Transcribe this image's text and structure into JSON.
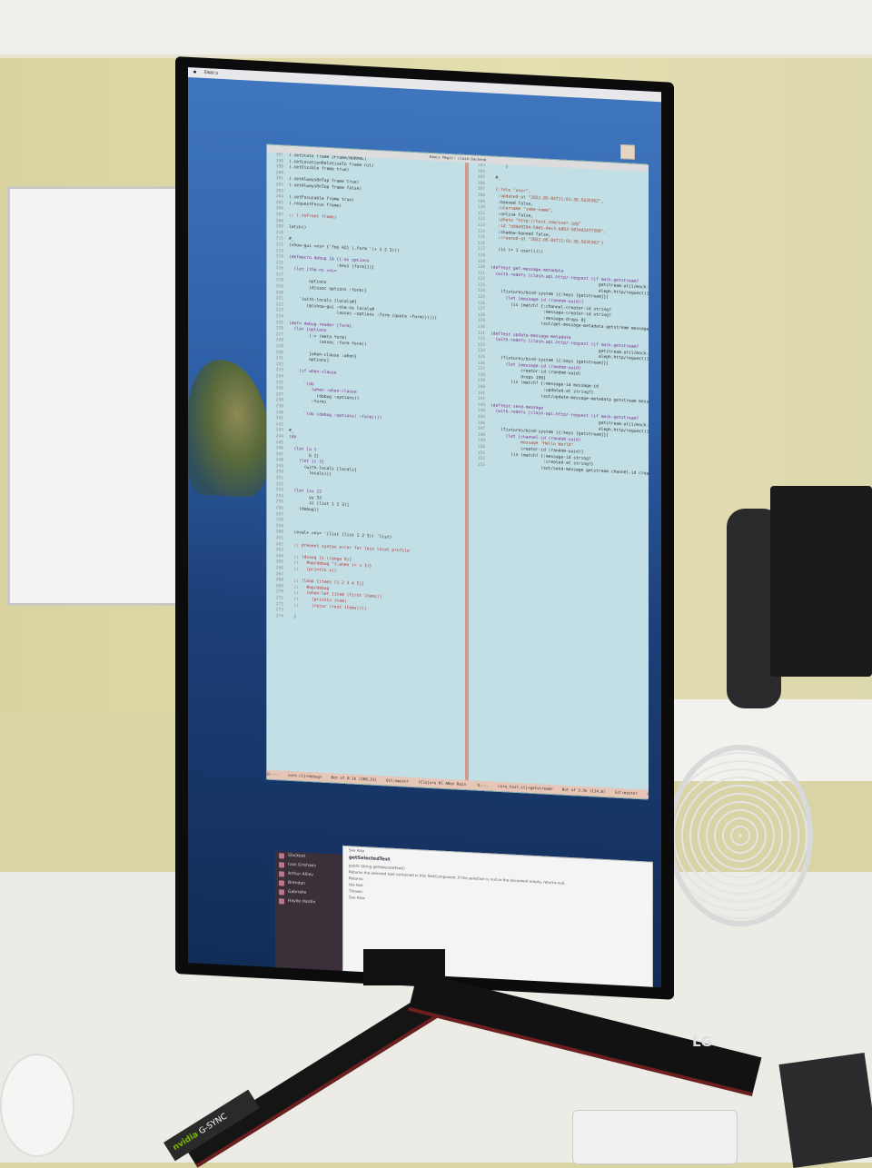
{
  "menubar": {
    "app": "Emacs"
  },
  "emacs": {
    "title": "Emacs Magit: clash-backend",
    "left_lines": [
      {
        "n": "197",
        "t": "(.setState frame JFrame/NORMAL)"
      },
      {
        "n": "198",
        "t": "(.setLocationRelativeTo frame nil)"
      },
      {
        "n": "199",
        "t": "(.setVisible frame true)"
      },
      {
        "n": "200",
        "t": ""
      },
      {
        "n": "201",
        "t": "(.setAlwaysOnTop frame true)"
      },
      {
        "n": "202",
        "t": "(.setAlwaysOnTop frame false)"
      },
      {
        "n": "203",
        "t": ""
      },
      {
        "n": "204",
        "t": "(.setFocusable frame true)"
      },
      {
        "n": "205",
        "t": "(.requestFocus frame)"
      },
      {
        "n": "206",
        "t": ""
      },
      {
        "n": "207",
        "t": ";; (.toFront frame)"
      },
      {
        "n": "208",
        "t": ""
      },
      {
        "n": "209",
        "t": "latch))"
      },
      {
        "n": "210",
        "t": ""
      },
      {
        "n": "211",
        "t": "#_"
      },
      {
        "n": "212",
        "t": "(show-gui =ns= {'foo 42} (.form '(+ 1 2 3)))"
      },
      {
        "n": "213",
        "t": ""
      },
      {
        "n": "214",
        "t": "(defmacro debug [& [{:as options"
      },
      {
        "n": "215",
        "t": "                   :keys [form]}]]"
      },
      {
        "n": "216",
        "t": "  (let [the-ns =ns="
      },
      {
        "n": "217",
        "t": ""
      },
      {
        "n": "218",
        "t": "        options"
      },
      {
        "n": "219",
        "t": "        (dissoc options :form)]"
      },
      {
        "n": "220",
        "t": ""
      },
      {
        "n": "221",
        "t": "    `(with-locals [locals#]"
      },
      {
        "n": "222",
        "t": "       (@(show-gui ~the-ns locals#"
      },
      {
        "n": "223",
        "t": "                   (assoc ~options :form (quote ~form))))))"
      },
      {
        "n": "224",
        "t": ""
      },
      {
        "n": "225",
        "t": "(defn debug-reader [form]"
      },
      {
        "n": "226",
        "t": "  (let [options"
      },
      {
        "n": "227",
        "t": "        (-> (meta form)"
      },
      {
        "n": "228",
        "t": "            (assoc :form form))"
      },
      {
        "n": "229",
        "t": ""
      },
      {
        "n": "230",
        "t": "        [when-clause :when}"
      },
      {
        "n": "231",
        "t": "        options]"
      },
      {
        "n": "232",
        "t": ""
      },
      {
        "n": "233",
        "t": "    (if when-clause"
      },
      {
        "n": "234",
        "t": ""
      },
      {
        "n": "235",
        "t": "      `(do"
      },
      {
        "n": "236",
        "t": "         (when ~when-clause"
      },
      {
        "n": "237",
        "t": "           (debug ~options))"
      },
      {
        "n": "238",
        "t": "         ~form)"
      },
      {
        "n": "239",
        "t": ""
      },
      {
        "n": "240",
        "t": "      `(do (debug ~options) ~form))))"
      },
      {
        "n": "241",
        "t": ""
      },
      {
        "n": "242",
        "t": ""
      },
      {
        "n": "243",
        "t": "#_"
      },
      {
        "n": "244",
        "t": "(do"
      },
      {
        "n": "245",
        "t": ""
      },
      {
        "n": "246",
        "t": "  (let [a 1"
      },
      {
        "n": "247",
        "t": "        b 2]"
      },
      {
        "n": "248",
        "t": "    (let [c 3]"
      },
      {
        "n": "249",
        "t": "      (with-locals [locals]"
      },
      {
        "n": "250",
        "t": "        locals)))"
      },
      {
        "n": "251",
        "t": ""
      },
      {
        "n": "252",
        "t": ""
      },
      {
        "n": "253",
        "t": "  (let [xx 22"
      },
      {
        "n": "254",
        "t": "        yy 33"
      },
      {
        "n": "255",
        "t": "        zz (list 1 2 3)]"
      },
      {
        "n": "256",
        "t": "    (debug))"
      },
      {
        "n": "257",
        "t": ""
      },
      {
        "n": "258",
        "t": ""
      },
      {
        "n": "259",
        "t": ""
      },
      {
        "n": "260",
        "t": "  (eval+ =ns= '(list (list 1 2 3)) 'list)"
      },
      {
        "n": "261",
        "t": ""
      },
      {
        "n": "262",
        "t": "  ;; prevent syntax error for lein local profile"
      },
      {
        "n": "263",
        "t": ""
      },
      {
        "n": "264",
        "t": "  ;; (doseq [x (range 9)]"
      },
      {
        "n": "265",
        "t": "  ;;   #op/debug ^{:when (= x 3)}"
      },
      {
        "n": "266",
        "t": "  ;;   (println x))"
      },
      {
        "n": "267",
        "t": ""
      },
      {
        "n": "268",
        "t": "  ;; (loop [items [1 2 3 4 5]]"
      },
      {
        "n": "269",
        "t": "  ;;   #op/debug"
      },
      {
        "n": "270",
        "t": "  ;;   (when-let [item (first items)]"
      },
      {
        "n": "271",
        "t": "  ;;     (println item)"
      },
      {
        "n": "272",
        "t": "  ;;     (recur (rest items))))"
      },
      {
        "n": "273",
        "t": ""
      },
      {
        "n": "274",
        "t": "  )"
      }
    ],
    "right_lines": [
      {
        "n": "103",
        "t": "      }"
      },
      {
        "n": "104",
        "t": ""
      },
      {
        "n": "105",
        "t": "  #_"
      },
      {
        "n": "106",
        "t": ""
      },
      {
        "n": "107",
        "t": "  {:role \"user\","
      },
      {
        "n": "108",
        "t": "   :updated-at \"2022-05-04T11:01:36.5635362\","
      },
      {
        "n": "109",
        "t": "   :banned false,"
      },
      {
        "n": "110",
        "t": "   :username \"some-name\","
      },
      {
        "n": "111",
        "t": "   :online false,"
      },
      {
        "n": "112",
        "t": "   :photo \"http://test.com/user.jpg\""
      },
      {
        "n": "113",
        "t": "   :id \"ddde9294-5dd1-4ec3-b8b3-5834d24f7398\","
      },
      {
        "n": "114",
        "t": "   :shadow-banned false,"
      },
      {
        "n": "115",
        "t": "   :created-at \"2022-05-04T11:01:36.5635362\"}"
      },
      {
        "n": "116",
        "t": ""
      },
      {
        "n": "117",
        "t": "   (is (= 1 user)))))"
      },
      {
        "n": "118",
        "t": ""
      },
      {
        "n": "119",
        "t": ""
      },
      {
        "n": "120",
        "t": "(deftest get-message-metadata"
      },
      {
        "n": "121",
        "t": "  (with-redefs [clash-api.http/-request (if mock-getstream?"
      },
      {
        "n": "122",
        "t": "                                           getstream.util/mock-get-message"
      },
      {
        "n": "123",
        "t": "                                           aleph.http/request)]"
      },
      {
        "n": "124",
        "t": "    (fixtures/bind-system [{:keys [getstream]}]"
      },
      {
        "n": "125",
        "t": "      (let [message-id (random-uuid)]"
      },
      {
        "n": "126",
        "t": "        (is (match? {:channel-creator-id string?"
      },
      {
        "n": "127",
        "t": "                     :message-creator-id string?"
      },
      {
        "n": "128",
        "t": "                     :message-drops 0}"
      },
      {
        "n": "129",
        "t": "                    (sut/get-message-metadata getstream message-id)))))))"
      },
      {
        "n": "130",
        "t": ""
      },
      {
        "n": "131",
        "t": "(deftest update-message-metadata"
      },
      {
        "n": "132",
        "t": "  (with-redefs [clash-api.http/-request (if mock-getstream?"
      },
      {
        "n": "133",
        "t": "                                           getstream.util/mock-update-mess"
      },
      {
        "n": "134",
        "t": "                                           aleph.http/request)]"
      },
      {
        "n": "135",
        "t": "    (fixtures/bind-system [{:keys [getstream]}]"
      },
      {
        "n": "136",
        "t": "      (let [message-id (random-uuid)"
      },
      {
        "n": "137",
        "t": "            creator-id (random-uuid)"
      },
      {
        "n": "138",
        "t": "            drops 199]"
      },
      {
        "n": "139",
        "t": "        (is (match? {:message-id message-id"
      },
      {
        "n": "140",
        "t": "                     :updated-at string?}"
      },
      {
        "n": "141",
        "t": "                    (sut/update-message-metadata getstream message-id cre"
      },
      {
        "n": "142",
        "t": ""
      },
      {
        "n": "143",
        "t": "(deftest send-message"
      },
      {
        "n": "144",
        "t": "  (with-redefs [clash-api.http/-request (if mock-getstream?"
      },
      {
        "n": "145",
        "t": "                                           getstream.util/mock-send-messag"
      },
      {
        "n": "146",
        "t": "                                           aleph.http/request)]"
      },
      {
        "n": "147",
        "t": "    (fixtures/bind-system [{:keys [getstream]}]"
      },
      {
        "n": "148",
        "t": "      (let [channel-id (random-uuid)"
      },
      {
        "n": "149",
        "t": "            message \"Hello World\""
      },
      {
        "n": "150",
        "t": "            creator-id (random-uuid)]"
      },
      {
        "n": "151",
        "t": "        (is (match? {:message-id string?"
      },
      {
        "n": "152",
        "t": "                     :created-at string?}"
      },
      {
        "n": "153",
        "t": "                    (sut/send-message getstream channel-id creator-id mes"
      }
    ],
    "modeline_left": [
      "U:---",
      "core.clj<debug>",
      "Bot of 8.1k (208,31)",
      "Git:master",
      "(Clojure Hl ARev Rain"
    ],
    "modeline_right": [
      "U:---",
      "core_test.clj<getstream>",
      "Bot of 3.5k (114,0)",
      "Git:master",
      "(Clojure Hl"
    ]
  },
  "docs": {
    "see_also_label": "See Also",
    "section_title": "getSelectedText",
    "signature": "public String getSelectedText()",
    "description": "Returns the selected text contained in this TextComponent. If the selection is null or the document empty, returns null.",
    "returns_label": "Returns:",
    "returns_text": "the text",
    "throws_label": "Throws:",
    "see_also_label_2": "See Also:"
  },
  "sidebar": {
    "items": [
      "Slackbot",
      "Ivan Grishaev",
      "Arthur Alliev",
      "Brendan",
      "Gabrielle",
      "Haylie Hardin"
    ]
  },
  "stand": {
    "logo": "LG",
    "badge_brand": "nvidia",
    "badge_tag": "G-SYNC"
  },
  "colors": {
    "editor_bg": "#c3dfe6",
    "divider": "#d09a8e",
    "modeline": "#e6c6b6",
    "desktop": "#2e5fa6"
  }
}
